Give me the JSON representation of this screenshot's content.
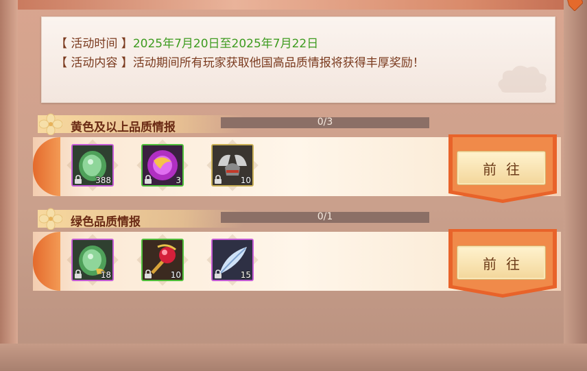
{
  "event": {
    "time_label": "【 活动时间 】",
    "time_value": "2025年7月20日至2025年7月22日",
    "content_label": "【 活动内容 】",
    "content_value": "活动期间所有玩家获取他国高品质情报将获得丰厚奖励！"
  },
  "sections": [
    {
      "title": "黄色及以上品质情报",
      "progress_text": "0/3",
      "progress_fraction": 0,
      "button_label": "前往",
      "rewards": [
        {
          "icon": "jade-dragon-icon",
          "quality": "purple",
          "count": "388"
        },
        {
          "icon": "purple-orb-icon",
          "quality": "green",
          "count": "3"
        },
        {
          "icon": "winged-helmet-icon",
          "quality": "gold",
          "count": "10"
        }
      ]
    },
    {
      "title": "绿色品质情报",
      "progress_text": "0/1",
      "progress_fraction": 0,
      "button_label": "前往",
      "rewards": [
        {
          "icon": "jade-dragon-icon",
          "quality": "purple",
          "count": "18"
        },
        {
          "icon": "red-gem-scepter-icon",
          "quality": "green",
          "count": "10"
        },
        {
          "icon": "feather-icon",
          "quality": "purple",
          "count": "15"
        }
      ]
    }
  ],
  "colors": {
    "green_text": "#3d9b1f",
    "brown_text": "#7a3a1e",
    "accent_orange": "#e46a2c"
  }
}
